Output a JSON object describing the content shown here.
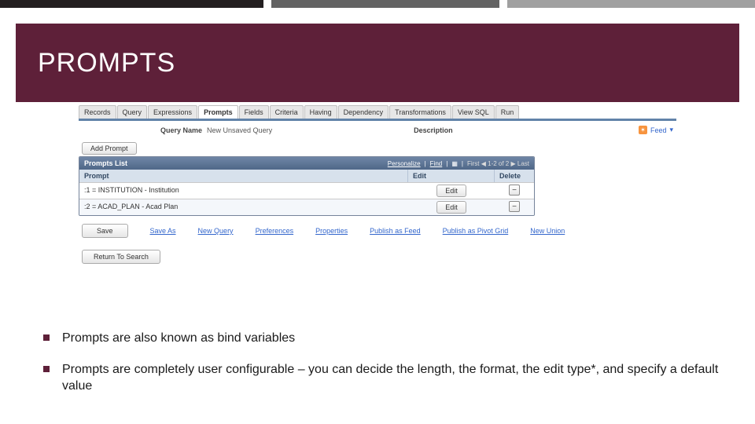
{
  "title": "PROMPTS",
  "tabs": [
    "Records",
    "Query",
    "Expressions",
    "Prompts",
    "Fields",
    "Criteria",
    "Having",
    "Dependency",
    "Transformations",
    "View SQL",
    "Run"
  ],
  "active_tab": "Prompts",
  "query_name_label": "Query Name",
  "query_name_value": "New Unsaved Query",
  "description_label": "Description",
  "feed_label": "Feed",
  "add_prompt_btn": "Add Prompt",
  "grid": {
    "title": "Prompts List",
    "personalize": "Personalize",
    "find": "Find",
    "nav": "First",
    "range": "1-2 of 2",
    "last": "Last",
    "col_prompt": "Prompt",
    "col_edit": "Edit",
    "col_delete": "Delete",
    "rows": [
      {
        "prompt": ":1 = INSTITUTION - Institution",
        "edit": "Edit"
      },
      {
        "prompt": ":2 = ACAD_PLAN - Acad Plan",
        "edit": "Edit"
      }
    ]
  },
  "actions": {
    "save": "Save",
    "save_as": "Save As",
    "new_query": "New Query",
    "preferences": "Preferences",
    "properties": "Properties",
    "publish_feed": "Publish as Feed",
    "publish_pivot": "Publish as Pivot Grid",
    "new_union": "New Union",
    "return_search": "Return To Search"
  },
  "bullets": [
    "Prompts are also known as bind variables",
    "Prompts are completely user configurable – you can decide the length, the format, the  edit type*, and specify a default value"
  ]
}
